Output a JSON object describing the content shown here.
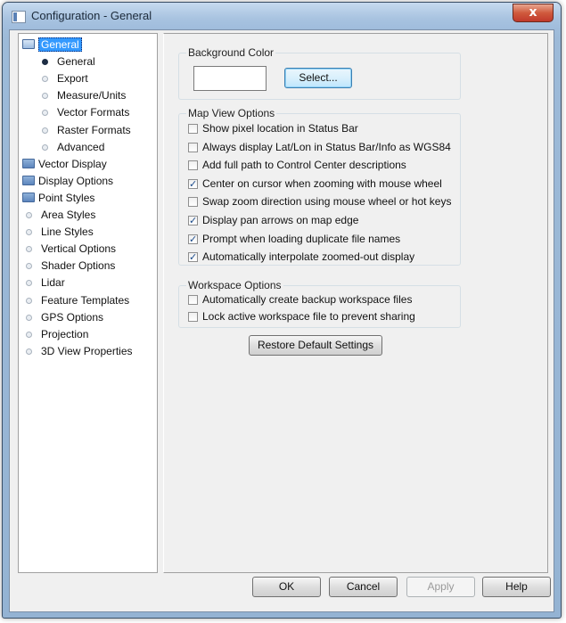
{
  "window": {
    "title": "Configuration - General",
    "close_glyph": "x"
  },
  "tree": {
    "items": [
      {
        "label": "General",
        "icon": "folder-open-icon",
        "selected": true,
        "level": 0
      },
      {
        "label": "General",
        "icon": "bullet-filled-icon",
        "level": 1
      },
      {
        "label": "Export",
        "icon": "bullet-icon",
        "level": 1
      },
      {
        "label": "Measure/Units",
        "icon": "bullet-icon",
        "level": 1
      },
      {
        "label": "Vector Formats",
        "icon": "bullet-icon",
        "level": 1
      },
      {
        "label": "Raster Formats",
        "icon": "bullet-icon",
        "level": 1
      },
      {
        "label": "Advanced",
        "icon": "bullet-icon",
        "level": 1
      },
      {
        "label": "Vector Display",
        "icon": "folder-icon",
        "level": 0
      },
      {
        "label": "Display Options",
        "icon": "folder-icon",
        "level": 0
      },
      {
        "label": "Point Styles",
        "icon": "folder-icon",
        "level": 0
      },
      {
        "label": "Area Styles",
        "icon": "bullet-icon",
        "level": 0
      },
      {
        "label": "Line Styles",
        "icon": "bullet-icon",
        "level": 0
      },
      {
        "label": "Vertical Options",
        "icon": "bullet-icon",
        "level": 0
      },
      {
        "label": "Shader Options",
        "icon": "bullet-icon",
        "level": 0
      },
      {
        "label": "Lidar",
        "icon": "bullet-icon",
        "level": 0
      },
      {
        "label": "Feature Templates",
        "icon": "bullet-icon",
        "level": 0
      },
      {
        "label": "GPS Options",
        "icon": "bullet-icon",
        "level": 0
      },
      {
        "label": "Projection",
        "icon": "bullet-icon",
        "level": 0
      },
      {
        "label": "3D View Properties",
        "icon": "bullet-icon",
        "level": 0
      }
    ]
  },
  "background_color": {
    "group_label": "Background Color",
    "select_label": "Select...",
    "swatch": "#ffffff"
  },
  "map_view": {
    "group_label": "Map View Options",
    "options": [
      {
        "label": "Show pixel location in Status Bar",
        "checked": false
      },
      {
        "label": "Always display Lat/Lon in Status Bar/Info as WGS84",
        "checked": false
      },
      {
        "label": "Add full path to Control Center descriptions",
        "checked": false
      },
      {
        "label": "Center on cursor when zooming with mouse wheel",
        "checked": true
      },
      {
        "label": "Swap zoom direction using mouse wheel or hot keys",
        "checked": false
      },
      {
        "label": "Display pan arrows on map edge",
        "checked": true
      },
      {
        "label": "Prompt when loading duplicate file names",
        "checked": true
      },
      {
        "label": "Automatically interpolate zoomed-out display",
        "checked": true
      }
    ]
  },
  "workspace": {
    "group_label": "Workspace Options",
    "options": [
      {
        "label": "Automatically create backup workspace files",
        "checked": false
      },
      {
        "label": "Lock active workspace file to prevent sharing",
        "checked": false
      }
    ]
  },
  "restore_label": "Restore Default Settings",
  "buttons": {
    "ok": "OK",
    "cancel": "Cancel",
    "apply": "Apply",
    "help": "Help"
  },
  "colors": {
    "selection": "#3399ff",
    "titlebar": "#a8c3e0"
  }
}
